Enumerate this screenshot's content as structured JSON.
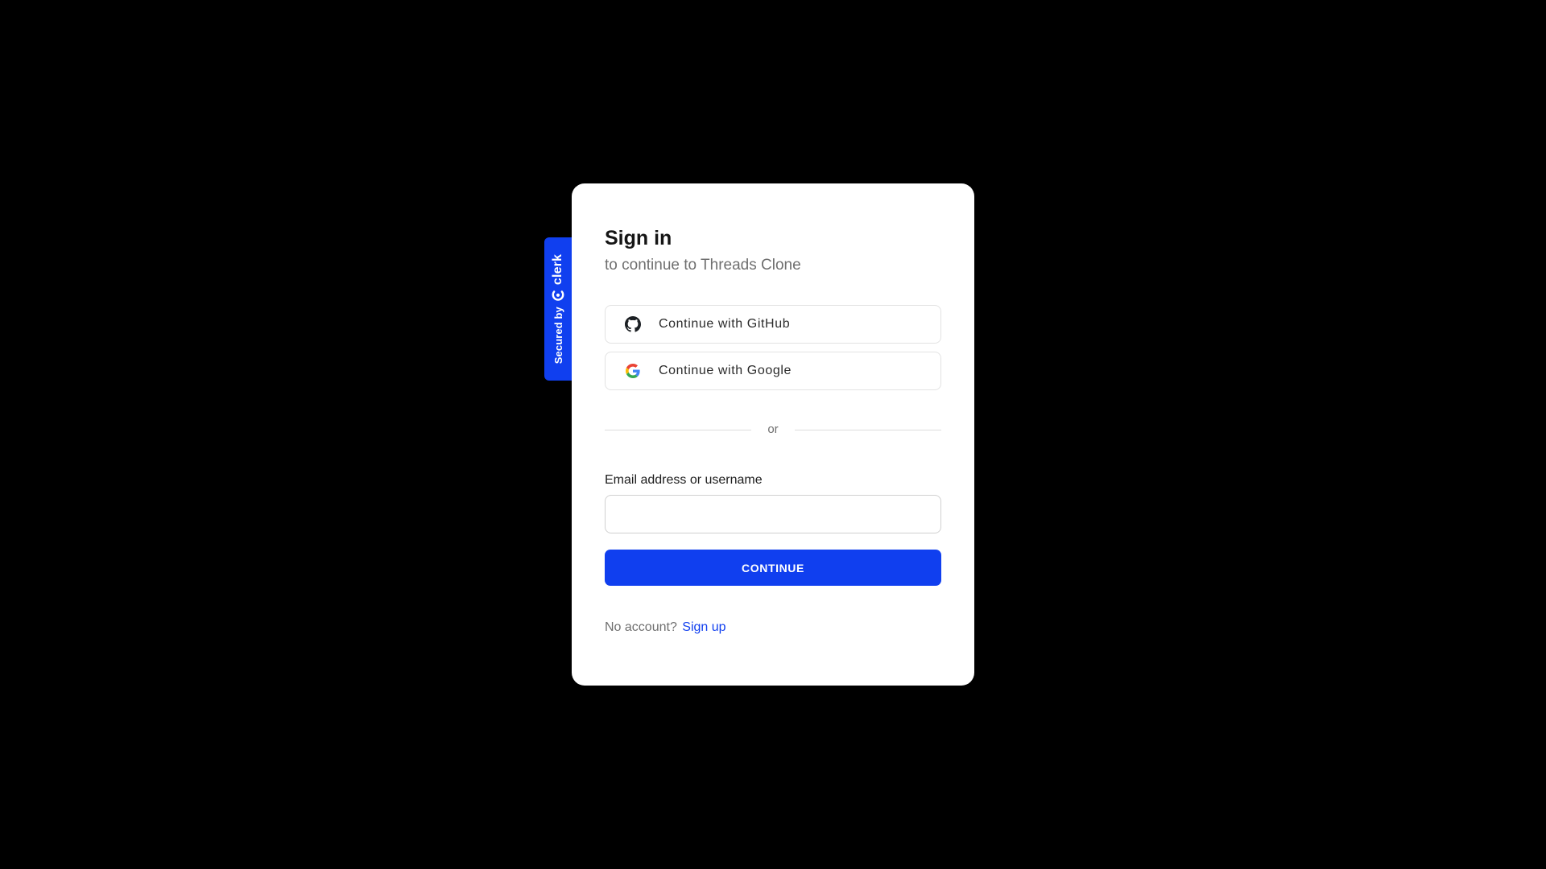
{
  "badge": {
    "secured_text": "Secured by",
    "brand": "clerk",
    "logo_icon": "clerk-logo-icon"
  },
  "signin": {
    "title": "Sign in",
    "subtitle": "to continue to Threads Clone"
  },
  "social": [
    {
      "label": "Continue with GitHub",
      "icon": "github-icon"
    },
    {
      "label": "Continue with Google",
      "icon": "google-icon"
    }
  ],
  "divider": {
    "text": "or"
  },
  "form": {
    "email_label": "Email address or username",
    "email_value": "",
    "email_placeholder": "",
    "continue_label": "CONTINUE"
  },
  "footer": {
    "prompt": "No account?",
    "signup_link": "Sign up"
  },
  "colors": {
    "background": "#000000",
    "card": "#ffffff",
    "accent": "#103fef"
  }
}
